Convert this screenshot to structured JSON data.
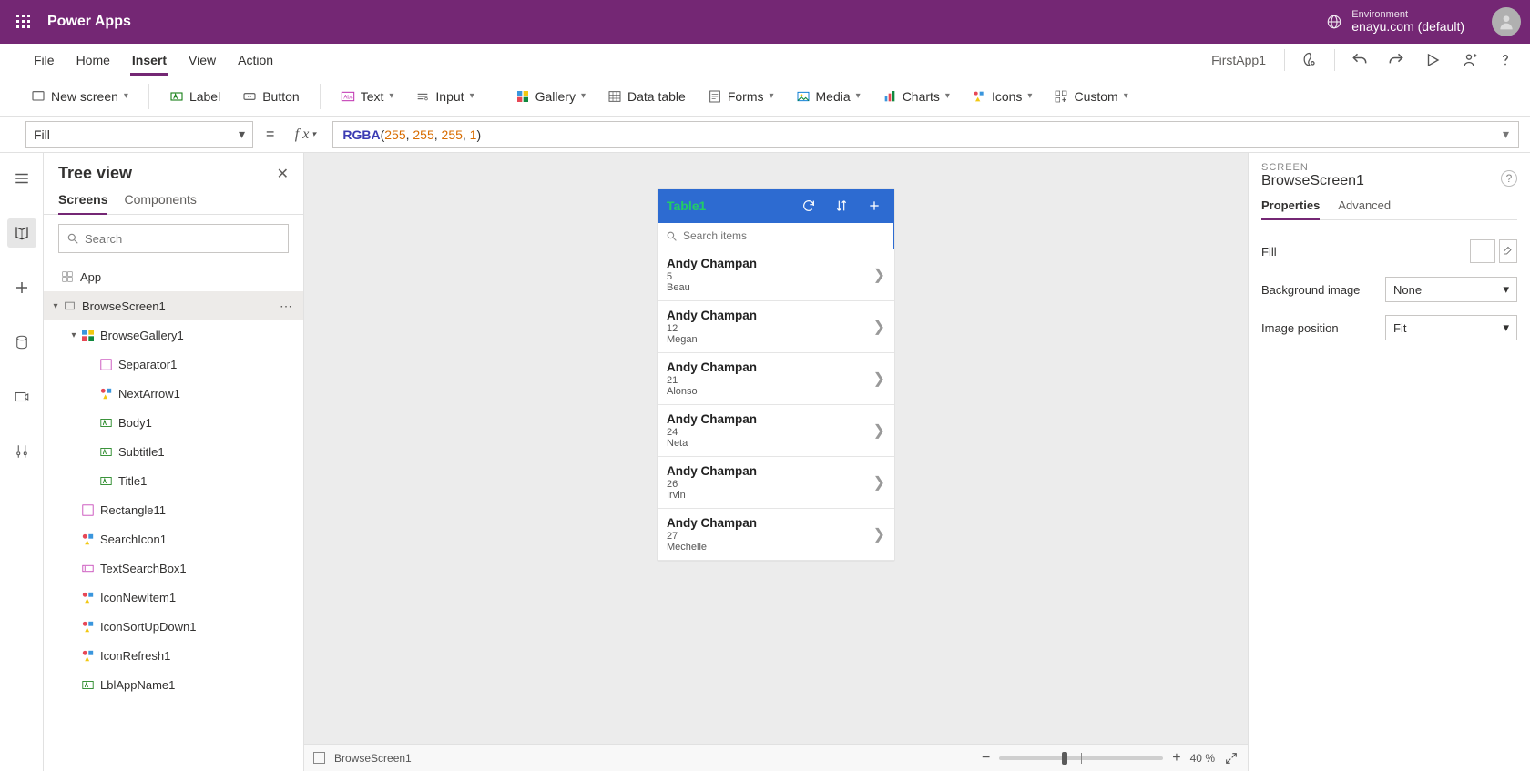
{
  "header": {
    "app_title": "Power Apps",
    "env_label": "Environment",
    "env_name": "enayu.com (default)"
  },
  "menu": {
    "items": [
      "File",
      "Home",
      "Insert",
      "View",
      "Action"
    ],
    "active": "Insert",
    "app_name": "FirstApp1"
  },
  "ribbon": {
    "new_screen": "New screen",
    "label": "Label",
    "button": "Button",
    "text": "Text",
    "input": "Input",
    "gallery": "Gallery",
    "data_table": "Data table",
    "forms": "Forms",
    "media": "Media",
    "charts": "Charts",
    "icons": "Icons",
    "custom": "Custom"
  },
  "formula": {
    "property": "Fill",
    "fn": "RGBA",
    "args": [
      "255",
      "255",
      "255",
      "1"
    ]
  },
  "tree": {
    "title": "Tree view",
    "tabs": [
      "Screens",
      "Components"
    ],
    "active_tab": "Screens",
    "search_placeholder": "Search",
    "nodes": {
      "app": "App",
      "screen": "BrowseScreen1",
      "gallery": "BrowseGallery1",
      "children_gallery": [
        "Separator1",
        "NextArrow1",
        "Body1",
        "Subtitle1",
        "Title1"
      ],
      "children_screen": [
        "Rectangle11",
        "SearchIcon1",
        "TextSearchBox1",
        "IconNewItem1",
        "IconSortUpDown1",
        "IconRefresh1",
        "LblAppName1"
      ]
    }
  },
  "phone": {
    "title": "Table1",
    "search_placeholder": "Search items",
    "items": [
      {
        "title": "Andy Champan",
        "sub1": "5",
        "sub2": "Beau"
      },
      {
        "title": "Andy Champan",
        "sub1": "12",
        "sub2": "Megan"
      },
      {
        "title": "Andy Champan",
        "sub1": "21",
        "sub2": "Alonso"
      },
      {
        "title": "Andy Champan",
        "sub1": "24",
        "sub2": "Neta"
      },
      {
        "title": "Andy Champan",
        "sub1": "26",
        "sub2": "Irvin"
      },
      {
        "title": "Andy Champan",
        "sub1": "27",
        "sub2": "Mechelle"
      }
    ]
  },
  "footer": {
    "crumb": "BrowseScreen1",
    "zoom_pct": "40",
    "zoom_suffix": "%"
  },
  "props": {
    "kind": "SCREEN",
    "name": "BrowseScreen1",
    "tabs": [
      "Properties",
      "Advanced"
    ],
    "active_tab": "Properties",
    "rows": {
      "fill": "Fill",
      "bg_image": "Background image",
      "bg_image_val": "None",
      "img_pos": "Image position",
      "img_pos_val": "Fit"
    }
  }
}
